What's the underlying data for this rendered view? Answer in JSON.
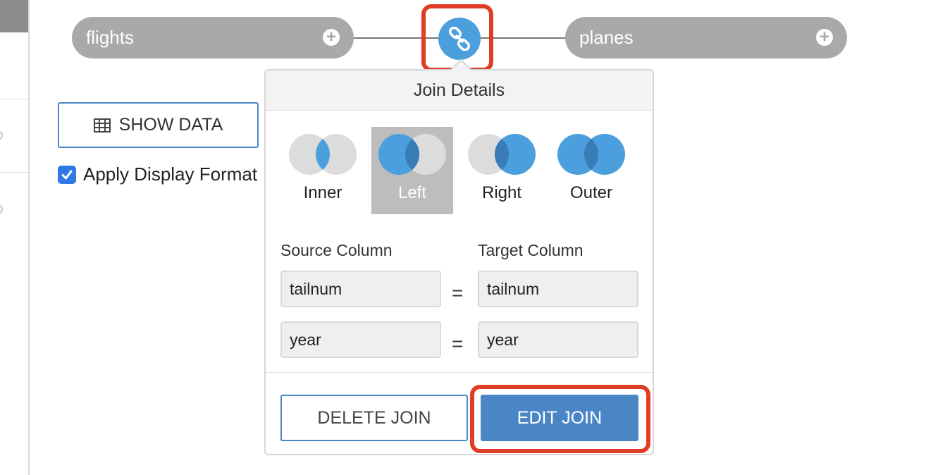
{
  "tables": {
    "left": {
      "name": "flights",
      "add_icon": "plus-circle-icon"
    },
    "right": {
      "name": "planes",
      "add_icon": "plus-circle-icon"
    },
    "link_icon": "chain-link-icon"
  },
  "toolbar": {
    "show_data_label": "SHOW DATA",
    "show_data_icon": "table-grid-icon",
    "apply_display_format_label": "Apply Display Format",
    "apply_display_format_checked": true
  },
  "join_details": {
    "title": "Join Details",
    "join_types": [
      {
        "label": "Inner",
        "selected": false
      },
      {
        "label": "Left",
        "selected": true
      },
      {
        "label": "Right",
        "selected": false
      },
      {
        "label": "Outer",
        "selected": false
      }
    ],
    "source_column_label": "Source Column",
    "target_column_label": "Target Column",
    "conditions": [
      {
        "source": "tailnum",
        "operator": "=",
        "target": "tailnum"
      },
      {
        "source": "year",
        "operator": "=",
        "target": "year"
      }
    ],
    "delete_label": "DELETE JOIN",
    "edit_label": "EDIT JOIN"
  },
  "colors": {
    "accent_blue": "#4a86c5",
    "venn_blue": "#4a9fdc",
    "venn_overlap": "#3a7cb8",
    "venn_grey": "#dcdcdc",
    "highlight_red": "#e03d27",
    "pill_grey": "#a9a9a9"
  }
}
